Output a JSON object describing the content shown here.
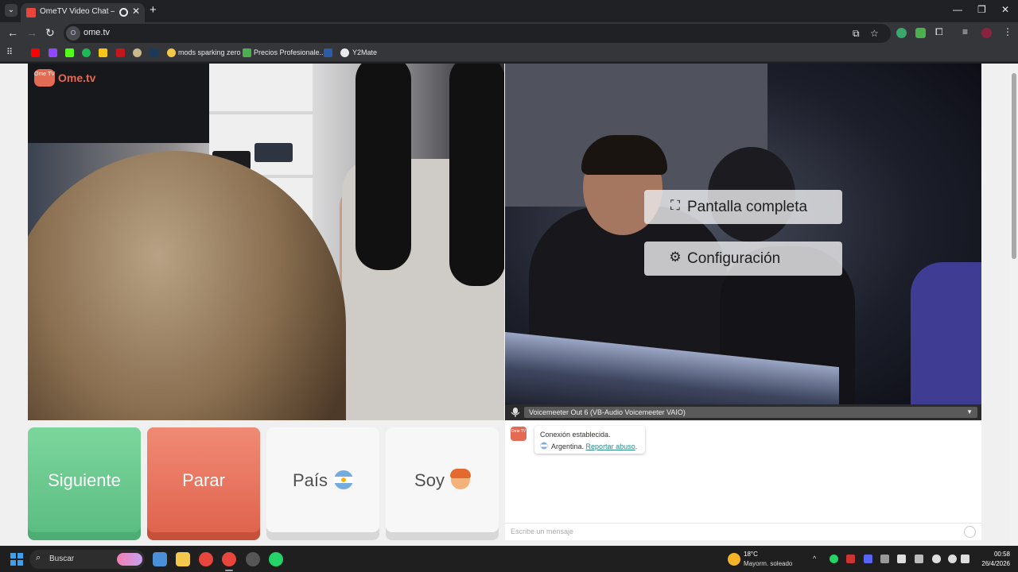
{
  "browser": {
    "tab": {
      "title": "OmeTV Video Chat — Ome"
    },
    "url": "ome.tv",
    "bookmarks": [
      {
        "label": "mods sparking zero"
      },
      {
        "label": "Precios Profesionale..."
      },
      {
        "label": "Y2Mate"
      }
    ]
  },
  "logo": {
    "bubble": "Ome TV",
    "text": "Ome.tv"
  },
  "remote_video": {
    "fullscreen_label": "Pantalla completa",
    "settings_label": "Configuración",
    "mic_device": "Voicemeeter Out 6 (VB-Audio Voicemeeter VAIO)"
  },
  "controls": {
    "next_label": "Siguiente",
    "stop_label": "Parar",
    "country_label": "País",
    "gender_label": "Soy"
  },
  "chat": {
    "status": "Conexión establecida.",
    "country": "Argentina.",
    "report_label": "Reportar abuso",
    "report_suffix": ".",
    "placeholder": "Escribe un mensaje"
  },
  "taskbar": {
    "search_placeholder": "Buscar",
    "weather_temp": "18°C",
    "weather_desc": "Mayorm. soleado",
    "time": "00:58",
    "date": "26/4/2026"
  },
  "colors": {
    "next": "#5cbd82",
    "stop": "#e0644e",
    "brand": "#e36b54",
    "link": "#2a8a8a"
  },
  "icons": [
    "tab-menu-icon",
    "favicon-icon",
    "audio-playing-icon",
    "close-icon",
    "plus-icon",
    "back-icon",
    "forward-icon",
    "reload-icon",
    "install-icon",
    "star-icon",
    "extensions-icon",
    "fullscreen-icon",
    "gear-icon",
    "microphone-icon",
    "flag-argentina-icon",
    "boy-avatar-icon",
    "emoji-icon",
    "windows-icon",
    "search-icon",
    "weather-icon"
  ]
}
